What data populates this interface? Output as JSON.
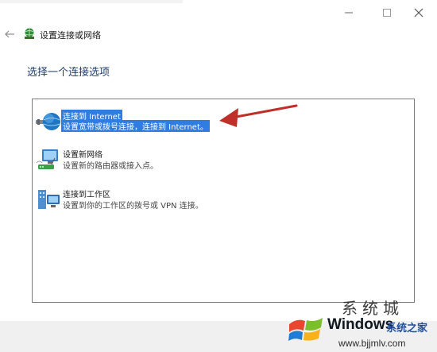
{
  "window": {
    "controls": {
      "minimize_icon": "minimize-icon",
      "maximize_icon": "maximize-icon",
      "close_icon": "close-icon"
    }
  },
  "header": {
    "back_icon": "back-arrow-icon",
    "icon": "network-globe-icon",
    "title": "设置连接或网络"
  },
  "main": {
    "heading": "选择一个连接选项",
    "options": [
      {
        "title": "连接到 Internet",
        "description": "设置宽带或拨号连接，连接到 Internet。",
        "icon": "globe-cable-icon",
        "selected": true
      },
      {
        "title": "设置新网络",
        "description": "设置新的路由器或接入点。",
        "icon": "router-computer-icon",
        "selected": false
      },
      {
        "title": "连接到工作区",
        "description": "设置到你的工作区的拨号或 VPN 连接。",
        "icon": "workplace-vpn-icon",
        "selected": false
      }
    ]
  },
  "watermark": {
    "top_text": "系统城",
    "brand": "Windows",
    "brand_cn": "系统之家",
    "url": "www.bjjmlv.com"
  },
  "colors": {
    "selection": "#2f7de1",
    "heading": "#1e3c6e",
    "annotation_arrow": "#c0302a"
  }
}
